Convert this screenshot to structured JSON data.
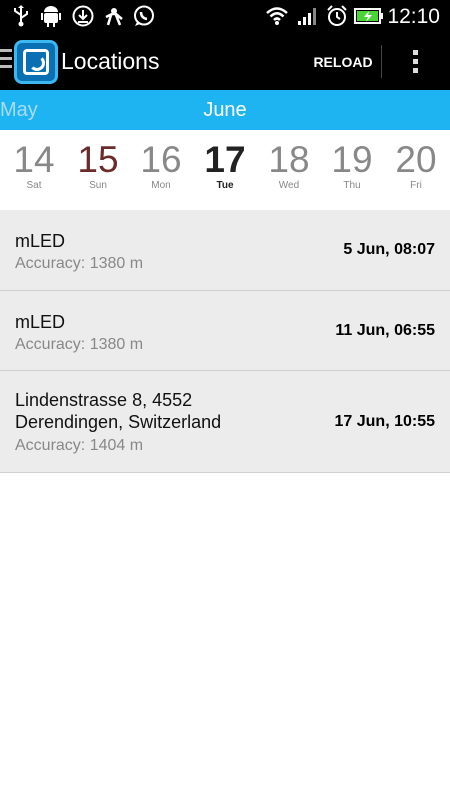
{
  "status_bar": {
    "time": "12:10",
    "icons": [
      "usb-icon",
      "android-debug-icon",
      "download-icon",
      "app-notification-icon",
      "whatsapp-icon",
      "wifi-icon",
      "signal-icon",
      "alarm-icon",
      "battery-charging-icon"
    ]
  },
  "action_bar": {
    "title": "Locations",
    "reload_label": "RELOAD",
    "accent": "#1eb4f2"
  },
  "calendar": {
    "prev_month": "May",
    "current_month": "June",
    "days": [
      {
        "num": "14",
        "weekday": "Sat"
      },
      {
        "num": "15",
        "weekday": "Sun"
      },
      {
        "num": "16",
        "weekday": "Mon"
      },
      {
        "num": "17",
        "weekday": "Tue"
      },
      {
        "num": "18",
        "weekday": "Wed"
      },
      {
        "num": "19",
        "weekday": "Thu"
      },
      {
        "num": "20",
        "weekday": "Fri"
      }
    ],
    "selected_day": "17"
  },
  "locations": [
    {
      "name": "mLED",
      "accuracy": "Accuracy: 1380 m",
      "time": "5 Jun, 08:07"
    },
    {
      "name": "mLED",
      "accuracy": "Accuracy: 1380 m",
      "time": "11 Jun, 06:55"
    },
    {
      "name": "Lindenstrasse 8, 4552 Derendingen, Switzerland",
      "accuracy": "Accuracy: 1404 m",
      "time": "17 Jun, 10:55"
    }
  ]
}
